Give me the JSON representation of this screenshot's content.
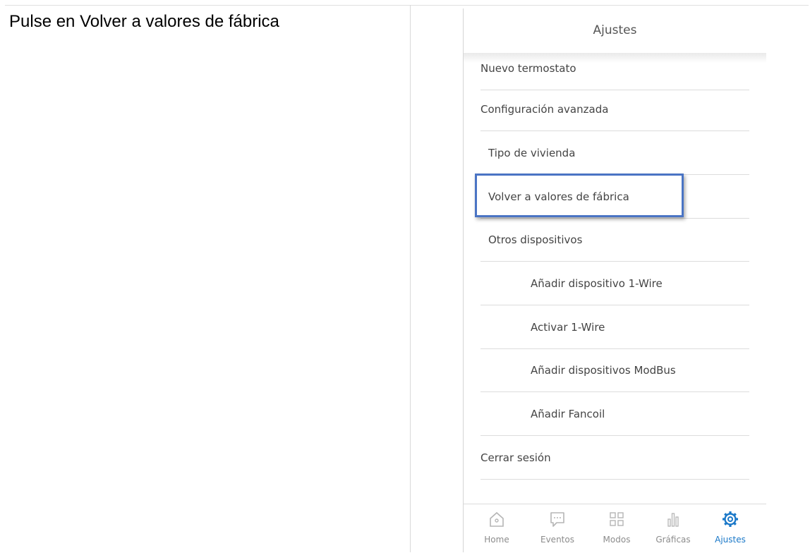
{
  "instruction": "Pulse en Volver a valores de fábrica",
  "app": {
    "header_title": "Ajustes",
    "menu": [
      {
        "label": "Nuevo termostato"
      },
      {
        "label": "Configuración avanzada"
      },
      {
        "label": "Tipo de vivienda"
      },
      {
        "label": "Volver a valores de fábrica"
      },
      {
        "label": "Otros dispositivos"
      },
      {
        "label": "Añadir dispositivo 1-Wire"
      },
      {
        "label": "Activar 1-Wire"
      },
      {
        "label": "Añadir dispositivos ModBus"
      },
      {
        "label": "Añadir Fancoil"
      },
      {
        "label": "Cerrar sesión"
      }
    ],
    "tabs": [
      {
        "label": "Home",
        "icon": "home-icon"
      },
      {
        "label": "Eventos",
        "icon": "chat-bubble-icon"
      },
      {
        "label": "Modos",
        "icon": "grid-icon"
      },
      {
        "label": "Gráficas",
        "icon": "bar-chart-icon"
      },
      {
        "label": "Ajustes",
        "icon": "gear-icon",
        "active": true
      }
    ]
  },
  "colors": {
    "accent": "#1a78c8",
    "highlight_border": "#4a74c4",
    "inactive_icon": "#b5b5b5"
  }
}
